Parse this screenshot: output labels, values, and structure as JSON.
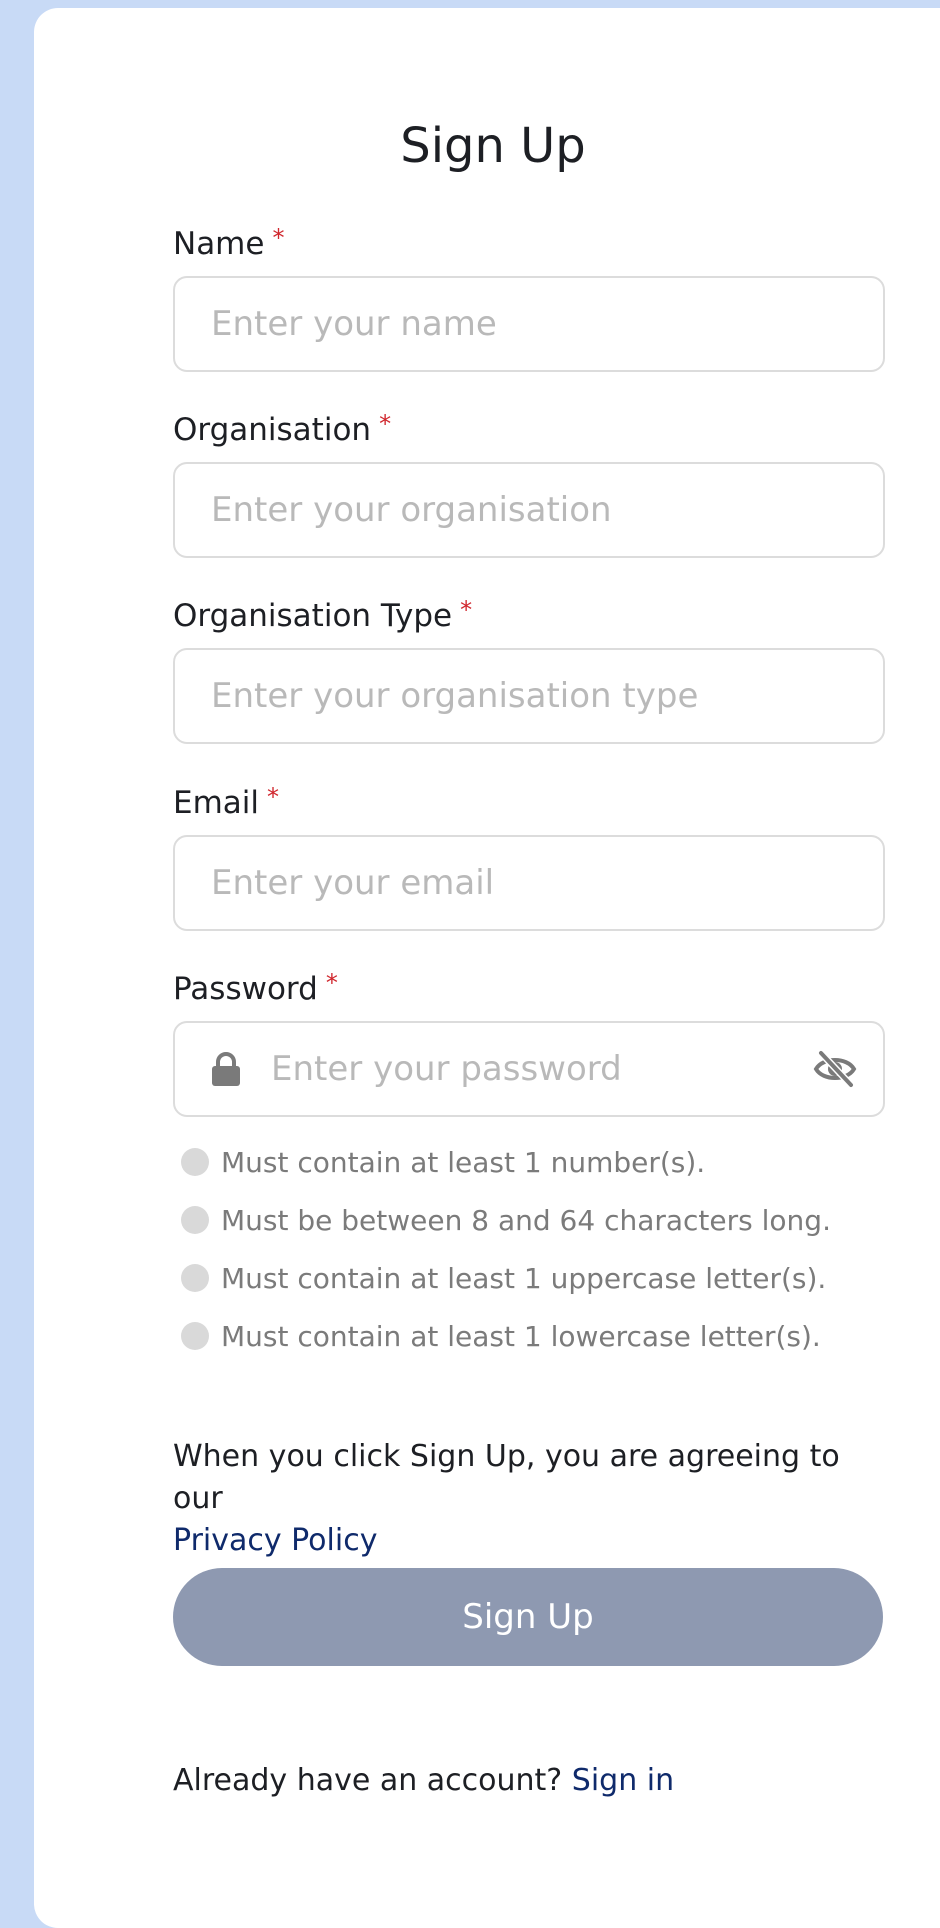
{
  "form": {
    "title": "Sign Up",
    "required_marker": "*",
    "fields": [
      {
        "label": "Name",
        "placeholder": "Enter your name",
        "value": ""
      },
      {
        "label": "Organisation",
        "placeholder": "Enter your organisation",
        "value": ""
      },
      {
        "label": "Organisation Type",
        "placeholder": "Enter your organisation type",
        "value": ""
      },
      {
        "label": "Email",
        "placeholder": "Enter your email",
        "value": ""
      },
      {
        "label": "Password",
        "placeholder": "Enter your password",
        "value": ""
      }
    ],
    "password_rules": [
      "Must contain at least 1 number(s).",
      "Must be between 8 and 64 characters long.",
      "Must contain at least 1 uppercase letter(s).",
      "Must contain at least 1 lowercase letter(s)."
    ],
    "agreement_text": "When you click Sign Up, you are agreeing to our",
    "privacy_link": "Privacy Policy",
    "submit_label": "Sign Up",
    "signin_prompt": "Already have an account?",
    "signin_link": "Sign in"
  },
  "icons": {
    "password_prefix": "lock-icon",
    "password_toggle": "eye-slash-icon"
  },
  "colors": {
    "page_background": "#c8daf6",
    "card_background": "#ffffff",
    "required": "#d0262d",
    "link": "#0f2a6b",
    "button_disabled": "#8e99b1",
    "rule_indicator": "#d9d9d9"
  }
}
